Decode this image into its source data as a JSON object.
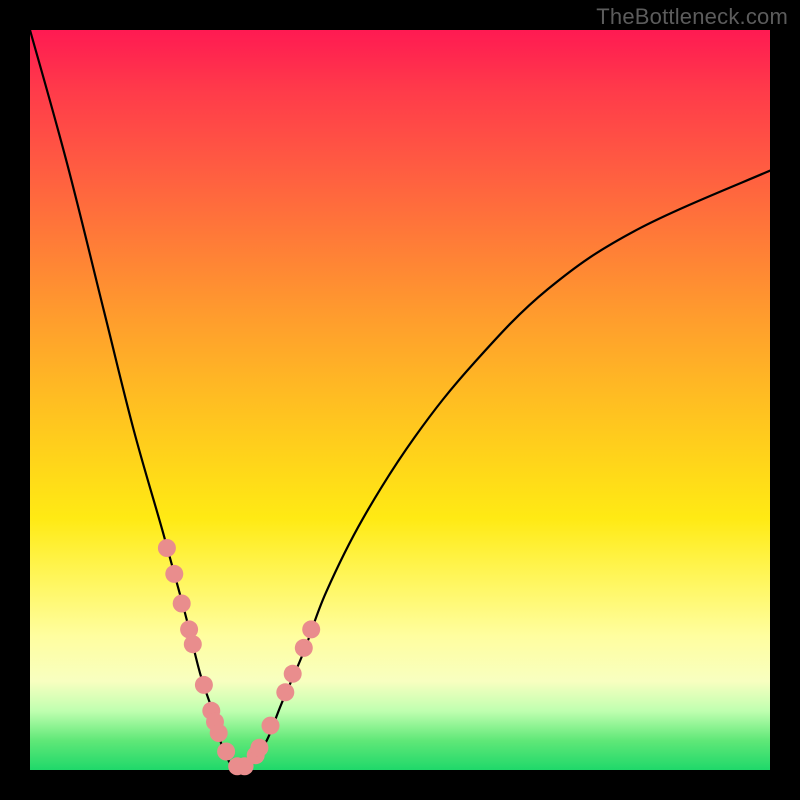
{
  "watermark": "TheBottleneck.com",
  "chart_data": {
    "type": "line",
    "title": "",
    "xlabel": "",
    "ylabel": "",
    "xlim": [
      0,
      100
    ],
    "ylim": [
      0,
      100
    ],
    "grid": false,
    "series": [
      {
        "name": "bottleneck-curve",
        "x": [
          0,
          5,
          10,
          14,
          18,
          21,
          23,
          25,
          26,
          27,
          28,
          29,
          30,
          32,
          34,
          37,
          40,
          45,
          52,
          60,
          70,
          82,
          100
        ],
        "values": [
          100,
          82,
          62,
          46,
          32,
          21,
          13,
          7,
          3,
          1,
          0,
          0,
          1,
          4,
          9,
          16,
          24,
          34,
          45,
          55,
          65,
          73,
          81
        ]
      }
    ],
    "markers": {
      "name": "highlight-dots",
      "color": "#e98d8d",
      "radius_px": 9,
      "x": [
        18.5,
        19.5,
        20.5,
        21.5,
        22.0,
        23.5,
        24.5,
        25.0,
        25.5,
        26.5,
        28.0,
        29.0,
        30.5,
        31.0,
        32.5,
        34.5,
        35.5,
        37.0,
        38.0
      ],
      "values": [
        30.0,
        26.5,
        22.5,
        19.0,
        17.0,
        11.5,
        8.0,
        6.5,
        5.0,
        2.5,
        0.5,
        0.5,
        2.0,
        3.0,
        6.0,
        10.5,
        13.0,
        16.5,
        19.0
      ]
    },
    "background": {
      "type": "vertical-gradient",
      "stops": [
        {
          "pos": 0.0,
          "color": "#ff1a52"
        },
        {
          "pos": 0.28,
          "color": "#ff7a38"
        },
        {
          "pos": 0.58,
          "color": "#ffd41a"
        },
        {
          "pos": 0.82,
          "color": "#fffea0"
        },
        {
          "pos": 0.96,
          "color": "#60e878"
        },
        {
          "pos": 1.0,
          "color": "#1fd86a"
        }
      ]
    }
  }
}
